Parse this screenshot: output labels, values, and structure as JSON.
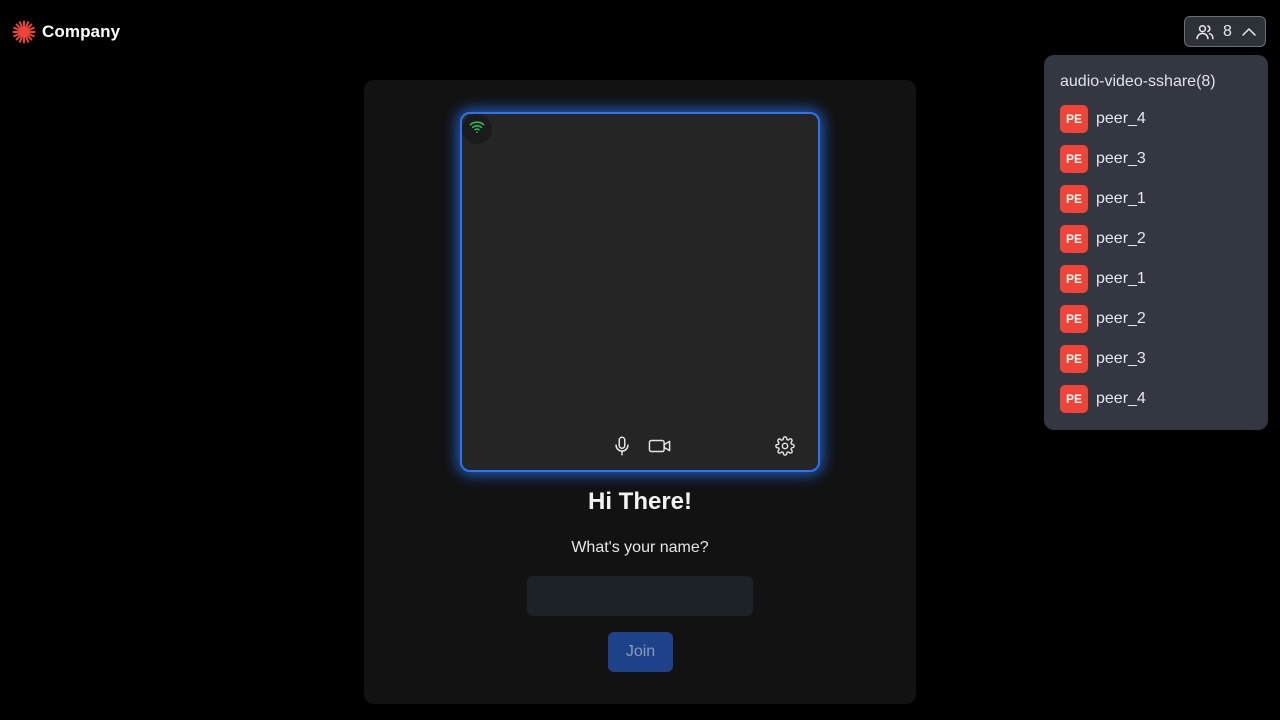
{
  "header": {
    "brand_name": "Company",
    "brand_color": "#f04438",
    "logo_icon": "burst-logo-icon",
    "participants_icon": "users-icon",
    "participants_count": "8",
    "participants_toggle_icon": "chevron-up-icon"
  },
  "participants_panel": {
    "title": "audio-video-sshare(8)",
    "avatar_color": "#f04438",
    "peers": [
      {
        "initials": "PE",
        "name": "peer_4"
      },
      {
        "initials": "PE",
        "name": "peer_3"
      },
      {
        "initials": "PE",
        "name": "peer_1"
      },
      {
        "initials": "PE",
        "name": "peer_2"
      },
      {
        "initials": "PE",
        "name": "peer_1"
      },
      {
        "initials": "PE",
        "name": "peer_2"
      },
      {
        "initials": "PE",
        "name": "peer_3"
      },
      {
        "initials": "PE",
        "name": "peer_4"
      }
    ]
  },
  "preview": {
    "border_color": "#2a74f0",
    "network_icon": "wifi-icon",
    "network_color": "#22c55e",
    "mic_icon": "microphone-icon",
    "camera_icon": "video-camera-icon",
    "settings_icon": "gear-icon"
  },
  "join_form": {
    "greeting": "Hi There!",
    "prompt": "What's your name?",
    "name_value": "",
    "name_placeholder": "",
    "join_label": "Join",
    "join_color": "#1d4289"
  }
}
